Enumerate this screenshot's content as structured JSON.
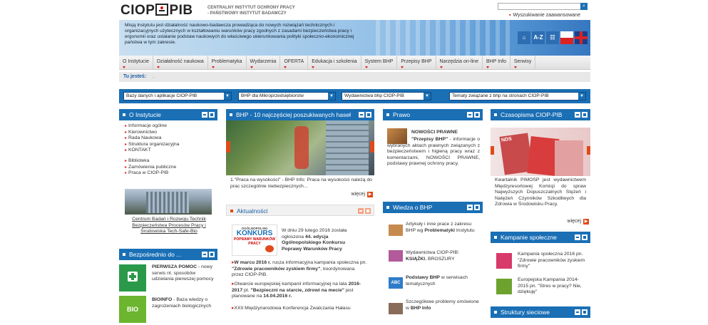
{
  "header": {
    "logo_left": "CIOP",
    "logo_right": "PIB",
    "org_line1": "CENTRALNY INSTYTUT OCHRONY PRACY",
    "org_line2": "- PAŃSTWOWY INSTYTUT BADAWCZY",
    "advanced_search": "Wyszukiwanie zaawansowane"
  },
  "banner": {
    "mission": "Misją Instytutu jest działalność naukowo-badawcza prowadząca do nowych rozwiązań technicznych i organizacyjnych użytecznych w kształtowaniu warunków pracy zgodnych z zasadami bezpieczeństwa pracy i ergonomii oraz ustalanie podstaw naukowych do właściwego ukierunkowania polityki społeczno-ekonomicznej państwa w tym zakresie.",
    "icons": [
      "home-icon",
      "A-Z",
      "sitemap-icon",
      "flag-pl-icon",
      "flag-en-icon"
    ],
    "az_label": "A-Z"
  },
  "mainnav": [
    "O Instytucie",
    "Działalność naukowa",
    "Problematyka",
    "Wydarzenia",
    "OFERTA",
    "Edukacja i szkolenia",
    "System BHP",
    "Przepisy BHP",
    "Narzędzia on-line",
    "BHP Info",
    "Serwisy"
  ],
  "breadcrumb": {
    "label": "Tu jesteś:",
    "value": ".."
  },
  "selects": [
    "Bazy danych i aplikacje CIOP-PIB",
    "BHP dla Mikroprzedsiębiorstw",
    "Wydawnictwa bhp CIOP-PIB",
    "Tematy związane z bhp na stronach CIOP-PIB"
  ],
  "o_instytucie": {
    "title": "O Instytucie",
    "links1": [
      "Informacje ogólne",
      "Kierownictwo",
      "Rada Naukowa",
      "Struktura organizacyjna",
      "KONTAKT"
    ],
    "links2": [
      "Biblioteka",
      "Zamówienia publiczne",
      "Praca w CIOP-PIB"
    ],
    "caption": "Centrum Badań i Rozwoju Technik Bezpieczeństwa Procesów Pracy i Środowiska Tech-Safe-Bio"
  },
  "bezposrednio": {
    "title": "Bezpośrednio do ...",
    "items": [
      {
        "title": "PIERWSZA POMOC",
        "desc": " - nowy serwis nt. sposobów udzielania pierwszej pomocy"
      },
      {
        "title": "BIOINFO",
        "desc": " - Baza wiedzy o zagrożeniach biologicznych"
      }
    ]
  },
  "top10": {
    "title": "BHP - 10 najczęściej poszukiwanych haseł",
    "caption": "1.\"Praca na wysokości\" - BHP Info: Praca na wysokości należą do prac szczególnie niebezpiecznych...",
    "more": "więcej"
  },
  "aktualnosci": {
    "title": "Aktualności",
    "badge_top": "OGÓLNOPOLSKI",
    "badge_main": "KONKURS",
    "badge_sub": "POPRAWY WARUNKÓW PRACY",
    "item1_pre": "W dniu 29 lutego 2016 została ogłoszona ",
    "item1_bold": "44. edycja Ogólnopolskiego Konkursu Poprawy Warunków Pracy",
    "item2_a": "W marcu 2016 r.",
    "item2_b": " rusza informacyjna kampania społeczna pn. ",
    "item2_c": "\"Zdrowie pracowników zyskiem firmy\"",
    "item2_d": ", koordynowana przez CIOP-PIB.",
    "item3_a": "Otwarcie europejskiej kampanii informacyjnej na lata ",
    "item3_b": "2016-2017",
    "item3_c": " pt. ",
    "item3_d": "\"Bezpieczni na starcie, zdrowi na mecie\"",
    "item3_e": " jest planowane na ",
    "item3_f": "14.04.2016 r.",
    "item4": "XXII Międzynarodowa Konferencja Zwalczania Hałasu"
  },
  "prawo": {
    "title": "Prawo",
    "heading": "NOWOŚCI PRAWNE",
    "bold": "\"Przepisy BHP\"",
    "text": " - informacje o wybranych aktach prawnych związanych z bezpieczeństwem i higieną pracy wraz z komentarzami, NOWOŚCI PRAWNE, podstawy prawnej ochrony pracy."
  },
  "wiedza": {
    "title": "Wiedza o BHP",
    "items": [
      {
        "pre": "Artykuły i inne prace z zakresu BHP wg ",
        "bold": "Problematyki",
        "post": " Instytutu"
      },
      {
        "pre": "Wydawnictwa CIOP-PIB: ",
        "bold": "KSIĄŻKI",
        "post": ", BROSZURY"
      },
      {
        "pre": "",
        "bold": "Podstawy BHP",
        "post": " w serwisach tematycznych"
      },
      {
        "pre": "Szczegółowe problemy omówione w ",
        "bold": "BHP Info",
        "post": ""
      }
    ]
  },
  "czasopisma": {
    "title": "Czasopisma CIOP-PIB",
    "text": "Kwartalnik PIMOSP jest wydawnictwem Międzyresortowej Komisji do spraw Najwyższych Dopuszczalnych Stężeń i Natężeń Czynników Szkodliwych dla Zdrowia w Środowisku Pracy.",
    "more": "więcej",
    "cover_label": "NDS"
  },
  "kampanie": {
    "title": "Kampanie społeczne",
    "items": [
      "Kampania społeczna 2016 pn. \"Zdrowie pracowników zyskiem firmy\"",
      "Europejska Kampania 2014-2015 pn. \"Stres w pracy? Nie, dziękuję\""
    ]
  },
  "struktury": {
    "title": "Struktury sieciowe"
  },
  "colors": {
    "brand_blue": "#1a6fb5",
    "accent_red": "#d22222",
    "accent_orange": "#e04a1a"
  }
}
